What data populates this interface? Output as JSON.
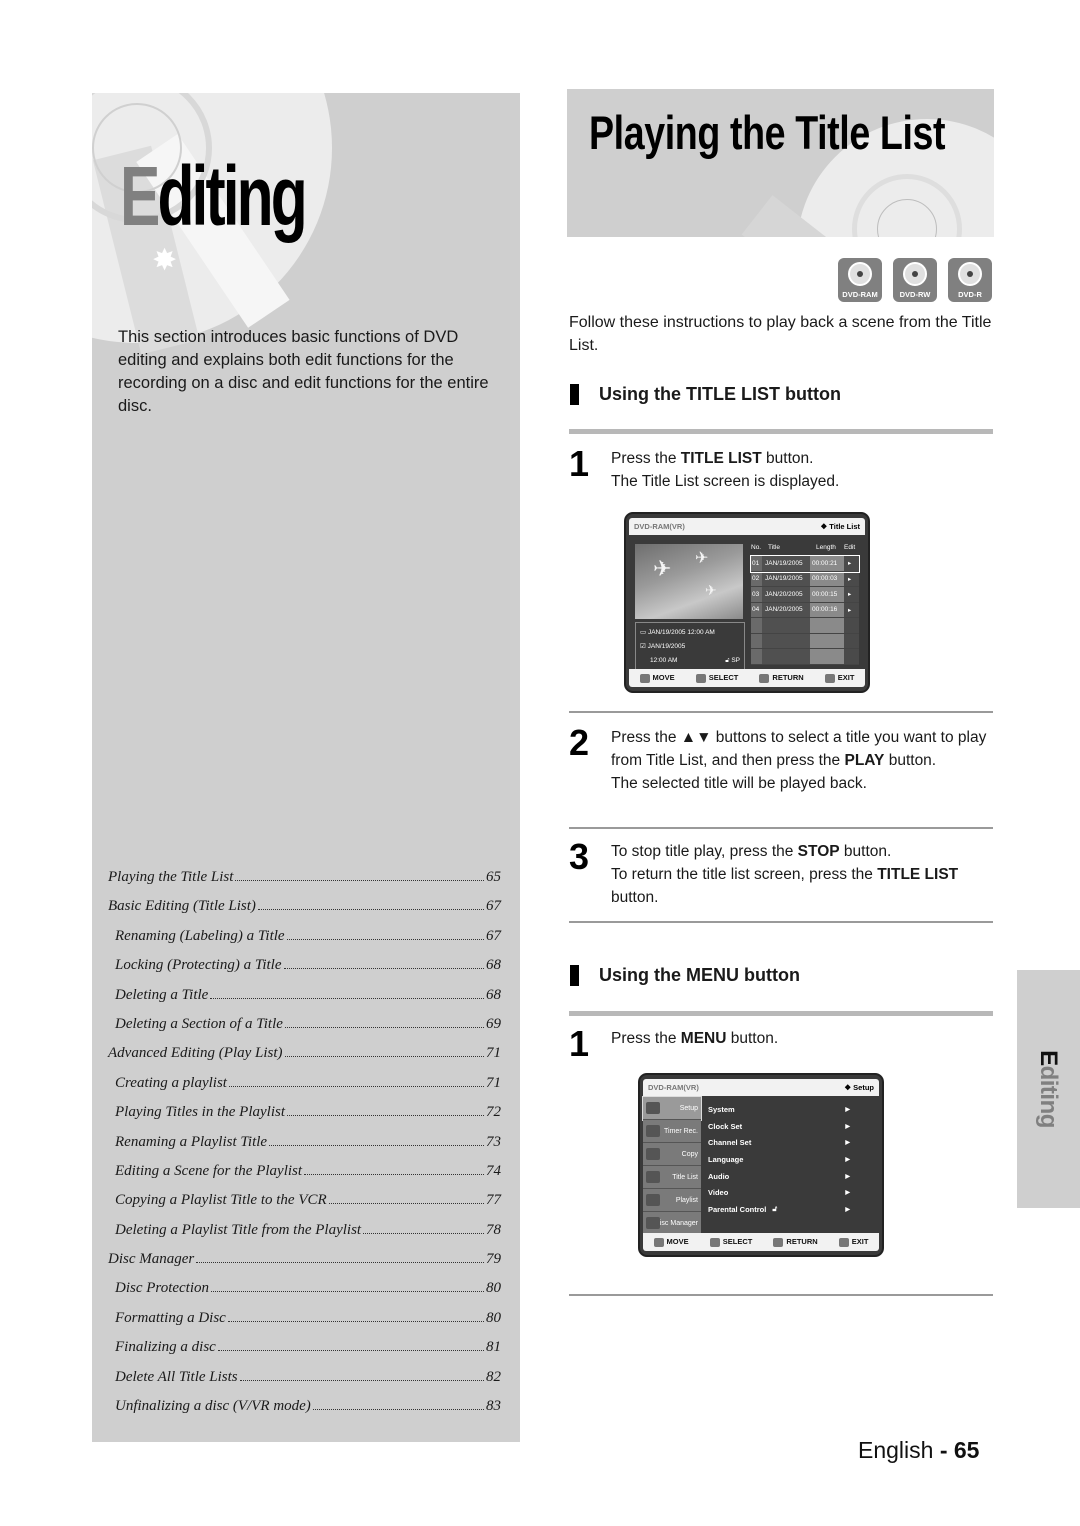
{
  "left_panel": {
    "section_title_first": "E",
    "section_title_rest": "diting",
    "intro": "This section introduces basic functions of DVD editing and explains both edit functions for the recording on a disc and edit functions for the entire disc.",
    "toc": [
      {
        "label": "Playing the Title List",
        "page": "65",
        "level": 0
      },
      {
        "label": "Basic Editing (Title List)",
        "page": "67",
        "level": 0
      },
      {
        "label": "Renaming (Labeling) a Title",
        "page": "67",
        "level": 1
      },
      {
        "label": "Locking (Protecting) a Title",
        "page": "68",
        "level": 1
      },
      {
        "label": "Deleting a Title",
        "page": "68",
        "level": 1
      },
      {
        "label": "Deleting a Section of a Title",
        "page": "69",
        "level": 1
      },
      {
        "label": "Advanced Editing (Play List)",
        "page": "71",
        "level": 0
      },
      {
        "label": "Creating a playlist",
        "page": "71",
        "level": 1
      },
      {
        "label": "Playing Titles in the Playlist",
        "page": "72",
        "level": 1
      },
      {
        "label": "Renaming a Playlist Title",
        "page": "73",
        "level": 1
      },
      {
        "label": "Editing a Scene for the Playlist",
        "page": "74",
        "level": 1
      },
      {
        "label": "Copying a Playlist Title to the VCR",
        "page": "77",
        "level": 1
      },
      {
        "label": "Deleting a Playlist Title from the Playlist",
        "page": "78",
        "level": 1
      },
      {
        "label": "Disc Manager",
        "page": "79",
        "level": 0
      },
      {
        "label": "Disc Protection",
        "page": "80",
        "level": 1
      },
      {
        "label": "Formatting a Disc",
        "page": "80",
        "level": 1
      },
      {
        "label": "Finalizing a disc",
        "page": "81",
        "level": 1
      },
      {
        "label": "Delete All Title Lists",
        "page": "82",
        "level": 1
      },
      {
        "label": "Unfinalizing a disc (V/VR mode)",
        "page": "83",
        "level": 1
      }
    ]
  },
  "header": {
    "page_title": "Playing the Title List",
    "disc_types": [
      "DVD-RAM",
      "DVD-RW",
      "DVD-R"
    ]
  },
  "intro_text": "Follow these instructions to play back a scene from the Title List.",
  "section1": {
    "heading": "Using the TITLE LIST button",
    "step1": {
      "num": "1",
      "pre": "Press the ",
      "bold": "TITLE LIST",
      "post": " button.",
      "line2": "The Title List screen is displayed."
    },
    "step2": {
      "num": "2",
      "pre": "Press the ▲▼ buttons to select a title you want to play from Title List, and then press the ",
      "bold": "PLAY",
      "post": " button.",
      "line2": "The selected title will be played back."
    },
    "step3": {
      "num": "3",
      "pre": "To stop title play, press the ",
      "bold": "STOP",
      "post": " button.",
      "pre2": "To return the title list screen, press the ",
      "bold2": "TITLE LIST",
      "post2": " button."
    }
  },
  "title_list_screen": {
    "mode": "DVD-RAM(VR)",
    "screen_name": "❖ Title List",
    "headers": {
      "no": "No.",
      "title": "Title",
      "length": "Length",
      "edit": "Edit"
    },
    "rows": [
      {
        "no": "01",
        "title": "JAN/19/2005",
        "length": "00:00:21",
        "edit": "▸",
        "selected": true
      },
      {
        "no": "02",
        "title": "JAN/19/2005",
        "length": "00:00:03",
        "edit": "▸",
        "selected": false
      },
      {
        "no": "03",
        "title": "JAN/20/2005",
        "length": "00:00:15",
        "edit": "▸",
        "selected": false
      },
      {
        "no": "04",
        "title": "JAN/20/2005",
        "length": "00:00:16",
        "edit": "▸",
        "selected": false
      }
    ],
    "info": {
      "recorded": "JAN/19/2005 12:00 AM",
      "date": "JAN/19/2005",
      "time": "12:00 AM",
      "quality": "SP"
    },
    "footer": {
      "move": "MOVE",
      "select": "SELECT",
      "return": "RETURN",
      "exit": "EXIT"
    }
  },
  "section2": {
    "heading": "Using the MENU button",
    "step1": {
      "num": "1",
      "pre": "Press the ",
      "bold": "MENU",
      "post": " button."
    }
  },
  "setup_screen": {
    "mode": "DVD-RAM(VR)",
    "screen_name": "❖ Setup",
    "left_menu": [
      "Setup",
      "Timer Rec.",
      "Copy",
      "Title List",
      "Playlist",
      "Disc Manager"
    ],
    "right_menu": [
      "System",
      "Clock Set",
      "Channel Set",
      "Language",
      "Audio",
      "Video",
      "Parental Control"
    ],
    "footer": {
      "move": "MOVE",
      "select": "SELECT",
      "return": "RETURN",
      "exit": "EXIT"
    }
  },
  "side_tab": {
    "first": "E",
    "rest": "diting"
  },
  "footer": {
    "language": "English",
    "separator": " - ",
    "page": "65"
  }
}
